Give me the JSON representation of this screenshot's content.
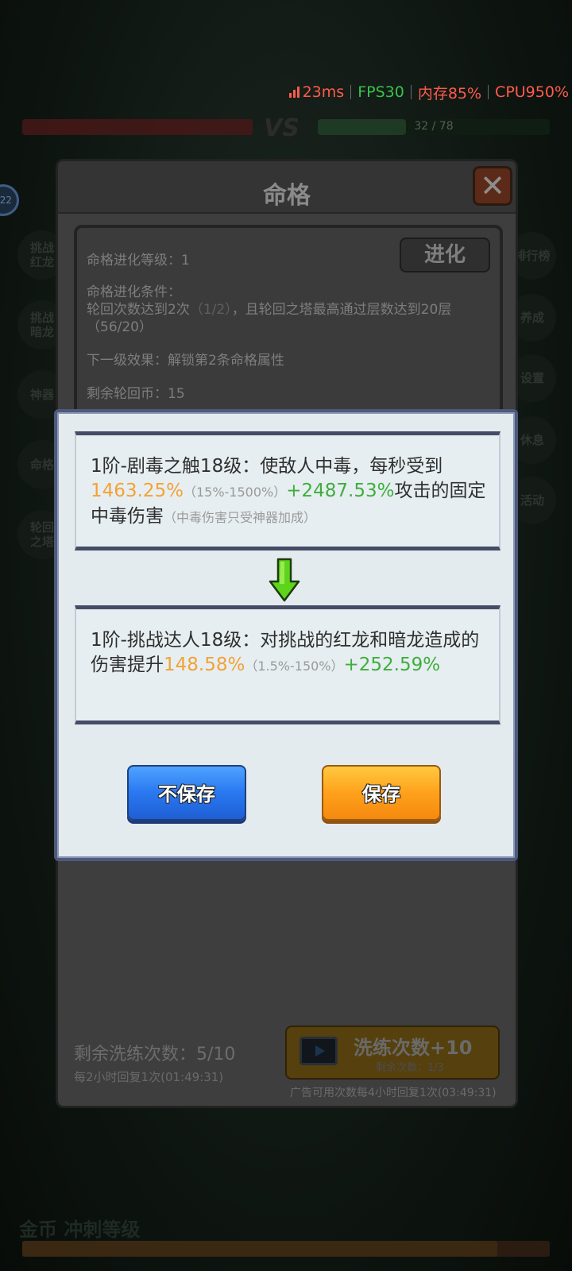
{
  "perf": {
    "ping": "23ms",
    "fps": "FPS30",
    "memory": "内存85%",
    "cpu": "CPU950%"
  },
  "hud": {
    "vs": "VS",
    "right_bar": "32 / 78",
    "level_badge": "22",
    "bottom_title": "金币 冲刺等级"
  },
  "panel": {
    "title": "命格",
    "close_glyph": "✕",
    "evolve_button": "进化",
    "evolve_level_label": "命格进化等级：1",
    "condition_label": "命格进化条件：",
    "condition_text_a": "轮回次数达到2次",
    "condition_progress_a": "（1/2）",
    "condition_text_b": "，且轮回之塔最高通过层数达到20层",
    "condition_progress_b": "（56/20）",
    "next_effect": "下一级效果：解锁第2条命格属性",
    "remaining_coins": "剩余轮回币：15",
    "remaining_wash": "剩余洗练次数：5/10",
    "regen_info": "每2小时回复1次(01:49:31)",
    "ad_button_main": "洗练次数+10",
    "ad_button_sub": "剩余次数：1/3",
    "ad_note": "广告可用次数每4小时回复1次(03:49:31)"
  },
  "dialog": {
    "old": {
      "prefix": "1阶-剧毒之触18级：使敌人中毒，每秒受到",
      "value": "1463.25%",
      "range": "（15%-1500%）",
      "bonus": "+2487.53%",
      "suffix": "攻击的固定中毒伤害",
      "note": "（中毒伤害只受神器加成）"
    },
    "new": {
      "prefix": "1阶-挑战达人18级：对挑战的红龙和暗龙造成的伤害提升",
      "value": "148.58%",
      "range": "（1.5%-150%）",
      "bonus": "+252.59%"
    },
    "no_save_button": "不保存",
    "save_button": "保存"
  },
  "colors": {
    "value_orange": "#f3a236",
    "bonus_green": "#3fae3c",
    "no_save_blue": "#2a78f0",
    "save_orange": "#ffa11c"
  },
  "side_buttons": {
    "left": [
      "挑战红龙",
      "挑战暗龙",
      "神器",
      "命格",
      "轮回之塔"
    ],
    "right": [
      "排行榜",
      "养成",
      "设置",
      "休息",
      "活动"
    ]
  }
}
